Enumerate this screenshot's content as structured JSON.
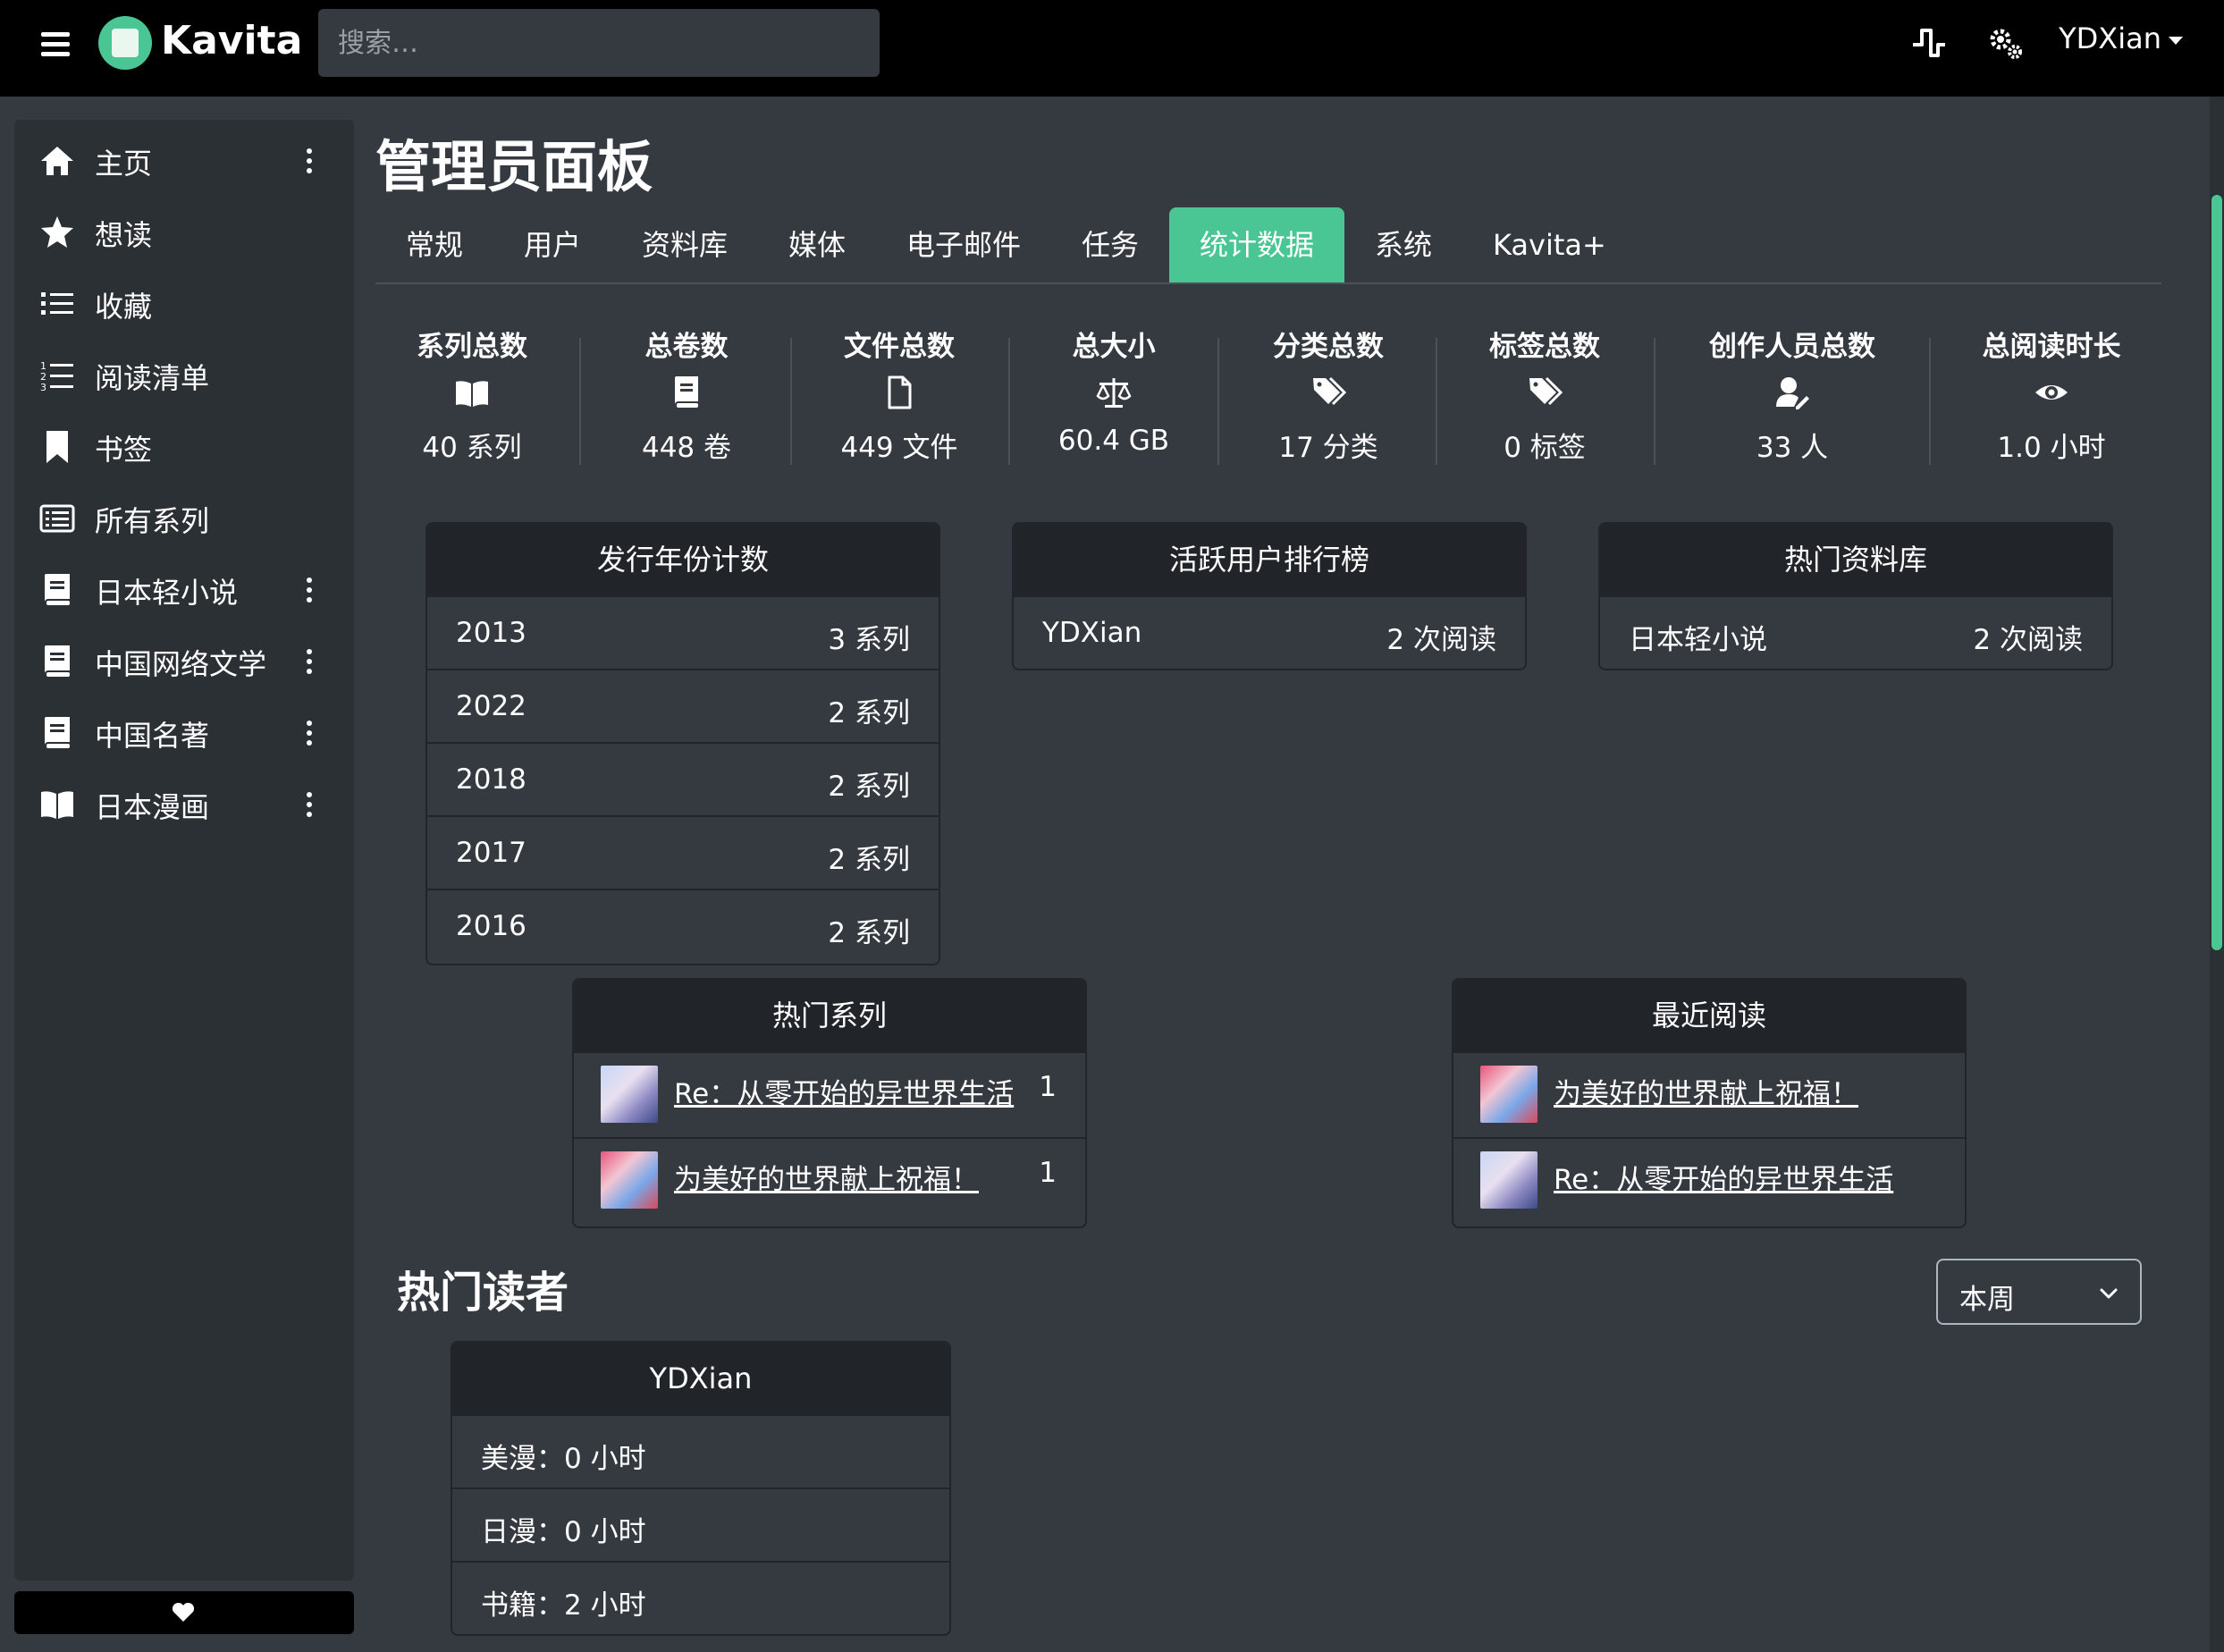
{
  "app": {
    "name": "Kavita"
  },
  "navbar": {
    "search_placeholder": "搜索…",
    "user": "YDXian",
    "icons": [
      "menu-icon",
      "activity-pulse-icon",
      "settings-gears-icon"
    ]
  },
  "sidebar": {
    "items": [
      {
        "label": "主页",
        "icon": "home-icon",
        "has_menu": true
      },
      {
        "label": "想读",
        "icon": "star-icon",
        "has_menu": false
      },
      {
        "label": "收藏",
        "icon": "list-icon",
        "has_menu": false
      },
      {
        "label": "阅读清单",
        "icon": "list-ol-icon",
        "has_menu": false
      },
      {
        "label": "书签",
        "icon": "bookmark-icon",
        "has_menu": false
      },
      {
        "label": "所有系列",
        "icon": "rectangle-list-icon",
        "has_menu": false
      },
      {
        "label": "日本轻小说",
        "icon": "book-icon",
        "has_menu": true
      },
      {
        "label": "中国网络文学",
        "icon": "book-icon",
        "has_menu": true
      },
      {
        "label": "中国名著",
        "icon": "book-icon",
        "has_menu": true
      },
      {
        "label": "日本漫画",
        "icon": "book-open-icon",
        "has_menu": true
      }
    ],
    "footer_icon": "heart-icon"
  },
  "page": {
    "title": "管理员面板"
  },
  "tabs": [
    {
      "label": "常规"
    },
    {
      "label": "用户"
    },
    {
      "label": "资料库"
    },
    {
      "label": "媒体"
    },
    {
      "label": "电子邮件"
    },
    {
      "label": "任务"
    },
    {
      "label": "统计数据",
      "active": true
    },
    {
      "label": "系统"
    },
    {
      "label": "Kavita+"
    }
  ],
  "stats": [
    {
      "title": "系列总数",
      "icon": "book-open-icon",
      "value": "40 系列"
    },
    {
      "title": "总卷数",
      "icon": "book-icon",
      "value": "448 卷"
    },
    {
      "title": "文件总数",
      "icon": "file-icon",
      "value": "449 文件"
    },
    {
      "title": "总大小",
      "icon": "scale-icon",
      "value": "60.4 GB"
    },
    {
      "title": "分类总数",
      "icon": "tags-icon",
      "value": "17 分类"
    },
    {
      "title": "标签总数",
      "icon": "tags-icon",
      "value": "0 标签"
    },
    {
      "title": "创作人员总数",
      "icon": "user-pen-icon",
      "value": "33 人"
    },
    {
      "title": "总阅读时长",
      "icon": "eye-icon",
      "value": "1.0 小时"
    }
  ],
  "release_years": {
    "title": "发行年份计数",
    "rows": [
      {
        "year": "2013",
        "count": "3 系列"
      },
      {
        "year": "2022",
        "count": "2 系列"
      },
      {
        "year": "2018",
        "count": "2 系列"
      },
      {
        "year": "2017",
        "count": "2 系列"
      },
      {
        "year": "2016",
        "count": "2 系列"
      }
    ]
  },
  "active_users": {
    "title": "活跃用户排行榜",
    "rows": [
      {
        "name": "YDXian",
        "value": "2 次阅读"
      }
    ]
  },
  "popular_libraries": {
    "title": "热门资料库",
    "rows": [
      {
        "name": "日本轻小说",
        "value": "2 次阅读"
      }
    ]
  },
  "popular_series": {
    "title": "热门系列",
    "rows": [
      {
        "name": "Re：从零开始的异世界生活",
        "value": "1"
      },
      {
        "name": "为美好的世界献上祝福！",
        "value": "1"
      }
    ]
  },
  "recently_read": {
    "title": "最近阅读",
    "rows": [
      {
        "name": "为美好的世界献上祝福！"
      },
      {
        "name": "Re：从零开始的异世界生活"
      }
    ]
  },
  "top_readers": {
    "title": "热门读者",
    "period": "本周",
    "reader": {
      "name": "YDXian",
      "rows": [
        {
          "text": "美漫：0 小时"
        },
        {
          "text": "日漫：0 小时"
        },
        {
          "text": "书籍：2 小时"
        }
      ]
    }
  },
  "colors": {
    "accent": "#4ac694",
    "background": "#343a40",
    "navbar": "#000000",
    "card_header": "#212529"
  }
}
